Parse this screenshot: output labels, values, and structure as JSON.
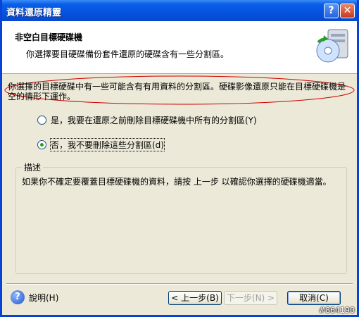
{
  "window": {
    "title": "資料還原精靈"
  },
  "header": {
    "title": "非空白目標硬碟機",
    "subtitle": "你選擇要目硬碟備份套件還原的硬碟含有一些分割區。"
  },
  "warning": "你選擇的目標硬碟中有一些可能含有有用資料的分割區。硬碟影像還原只能在目標硬碟機是空的情形下運作。",
  "options": [
    {
      "label": "是，我要在還原之前刪除目標硬碟機中所有的分割區(Y)",
      "selected": false
    },
    {
      "label": "否，我不要刪除這些分割區(d)",
      "selected": true
    }
  ],
  "description": {
    "label": "描述",
    "text": "如果你不確定要覆蓋目標硬碟機的資料，請按 上一步 以確認你選擇的硬碟機適當。"
  },
  "footer": {
    "help": "說明(H)",
    "back": "< 上一步(B)",
    "next": "下一步(N) >",
    "cancel": "取消(C)"
  },
  "watermark": "#864190",
  "colors": {
    "accent": "#0a5ee8",
    "annotation": "#cc0000",
    "radio_selected": "#21a121"
  }
}
